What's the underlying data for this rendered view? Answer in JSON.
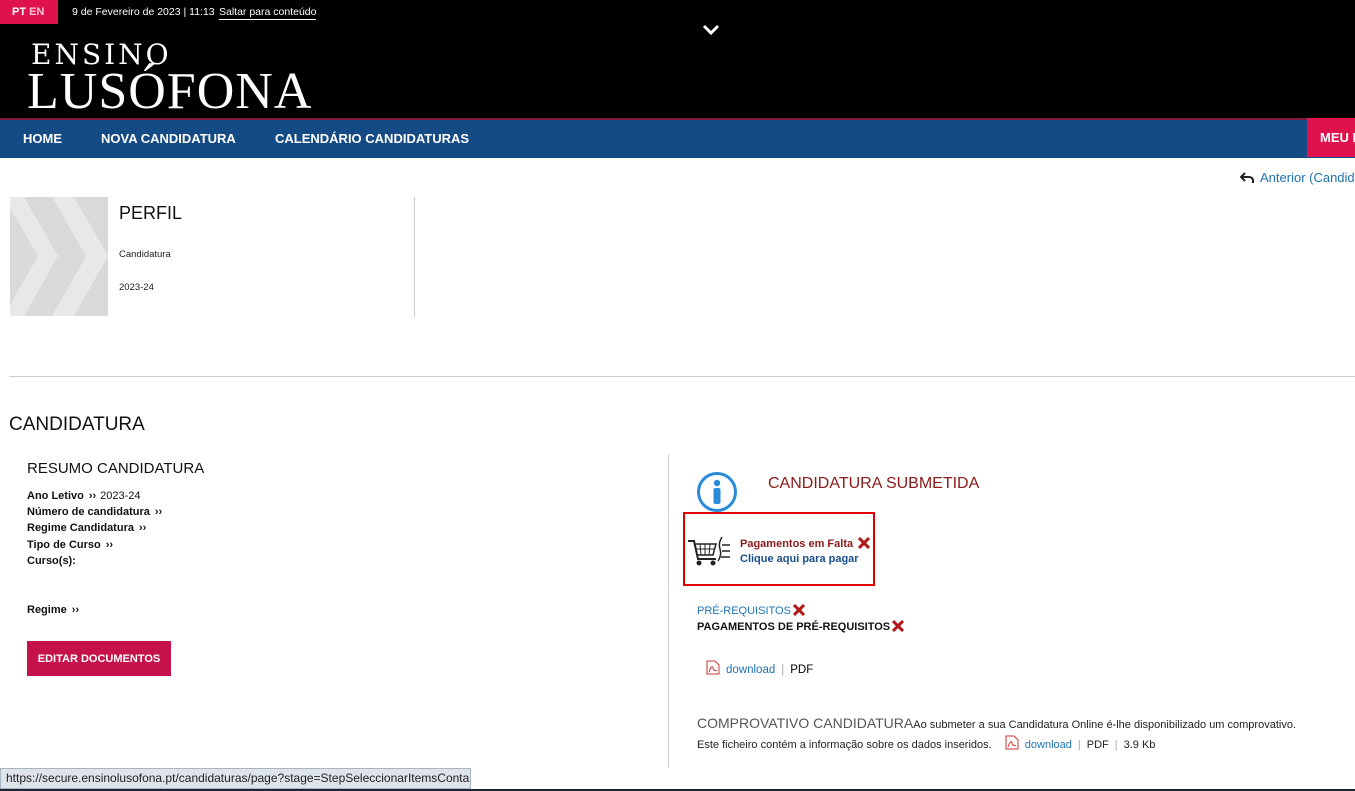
{
  "topbar": {
    "lang_pt": "PT",
    "lang_en": "EN",
    "date": "9 de Fevereiro de 2023 | 11:13",
    "skip_link": "Saltar para conteúdo",
    "logo_top": "ENSINO",
    "logo_bottom": "LUSÓFONA",
    "accent_color": "#e0124d"
  },
  "nav": {
    "items": [
      "HOME",
      "NOVA CANDIDATURA",
      "CALENDÁRIO CANDIDATURAS"
    ],
    "meu": "MEU I",
    "bg_color": "#154b84"
  },
  "back_link": "Anterior (Candid",
  "profile": {
    "title": "PERFIL",
    "subtitle": "Candidatura",
    "year": "2023-24"
  },
  "section_title": "CANDIDATURA",
  "resumo": {
    "title": "RESUMO CANDIDATURA",
    "fields": [
      {
        "label": "Ano Letivo",
        "value": "2023-24"
      },
      {
        "label": "Número de candidatura",
        "value": ""
      },
      {
        "label": "Regime Candidatura",
        "value": ""
      },
      {
        "label": "Tipo de Curso",
        "value": ""
      },
      {
        "label": "Curso(s):",
        "value": ""
      },
      {
        "label": "Regime",
        "value": ""
      }
    ],
    "edit_button": "EDITAR DOCUMENTOS"
  },
  "status": {
    "submetida": "CANDIDATURA SUBMETIDA",
    "payments_missing": "Pagamentos em Falta",
    "payments_click": "Clique aqui para pagar",
    "prereq": "PRÉ-REQUISITOS",
    "prereq_payments": "PAGAMENTOS DE PRÉ-REQUISITOS",
    "download_label": "download",
    "pdf_label": "PDF",
    "comprovativo_title": "COMPROVATIVO CANDIDATURA",
    "comprovativo_text": "Ao submeter a sua Candidatura Online é-lhe disponibilizado um comprovativo. Este ficheiro contém a informação sobre os dados inseridos.",
    "comprovativo_size": "3.9 Kb"
  },
  "statusbar_url": "https://secure.ensinolusofona.pt/candidaturas/page?stage=StepSeleccionarItemsConta"
}
